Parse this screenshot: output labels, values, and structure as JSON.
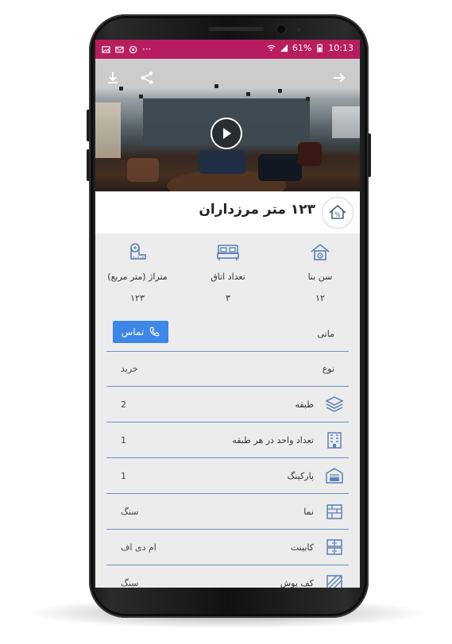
{
  "status_bar": {
    "battery": "61%",
    "time": "10:13",
    "dots": "···"
  },
  "listing": {
    "title": "۱۲۳ متر مرزداران"
  },
  "stats": [
    {
      "label": "سن بنا",
      "value": "۱۲",
      "icon": "house-age-icon"
    },
    {
      "label": "تعداد اتاق",
      "value": "۳",
      "icon": "bed-icon"
    },
    {
      "label": "متراژ (متر مربع)",
      "value": "۱۲۳",
      "icon": "tape-measure-icon"
    }
  ],
  "contact": {
    "owner_label": "مانی",
    "button_label": "تماس"
  },
  "details": [
    {
      "label": "نوع",
      "value": "خرید",
      "icon": ""
    },
    {
      "label": "طبقه",
      "value": "2",
      "icon": "layers-icon"
    },
    {
      "label": "تعداد واحد در هر طبقه",
      "value": "1",
      "icon": "building-icon"
    },
    {
      "label": "پارکینگ",
      "value": "1",
      "icon": "garage-icon"
    },
    {
      "label": "نما",
      "value": "سنگ",
      "icon": "facade-icon"
    },
    {
      "label": "کابینت",
      "value": "ام دی اف",
      "icon": "cabinet-icon"
    },
    {
      "label": "کف پوش",
      "value": "سنگ",
      "icon": "floor-tile-icon"
    }
  ],
  "colors": {
    "status_bar": "#b81e5f",
    "accent": "#3e86e8",
    "icon": "#5b7fb5",
    "divider": "#6c8fbf"
  }
}
